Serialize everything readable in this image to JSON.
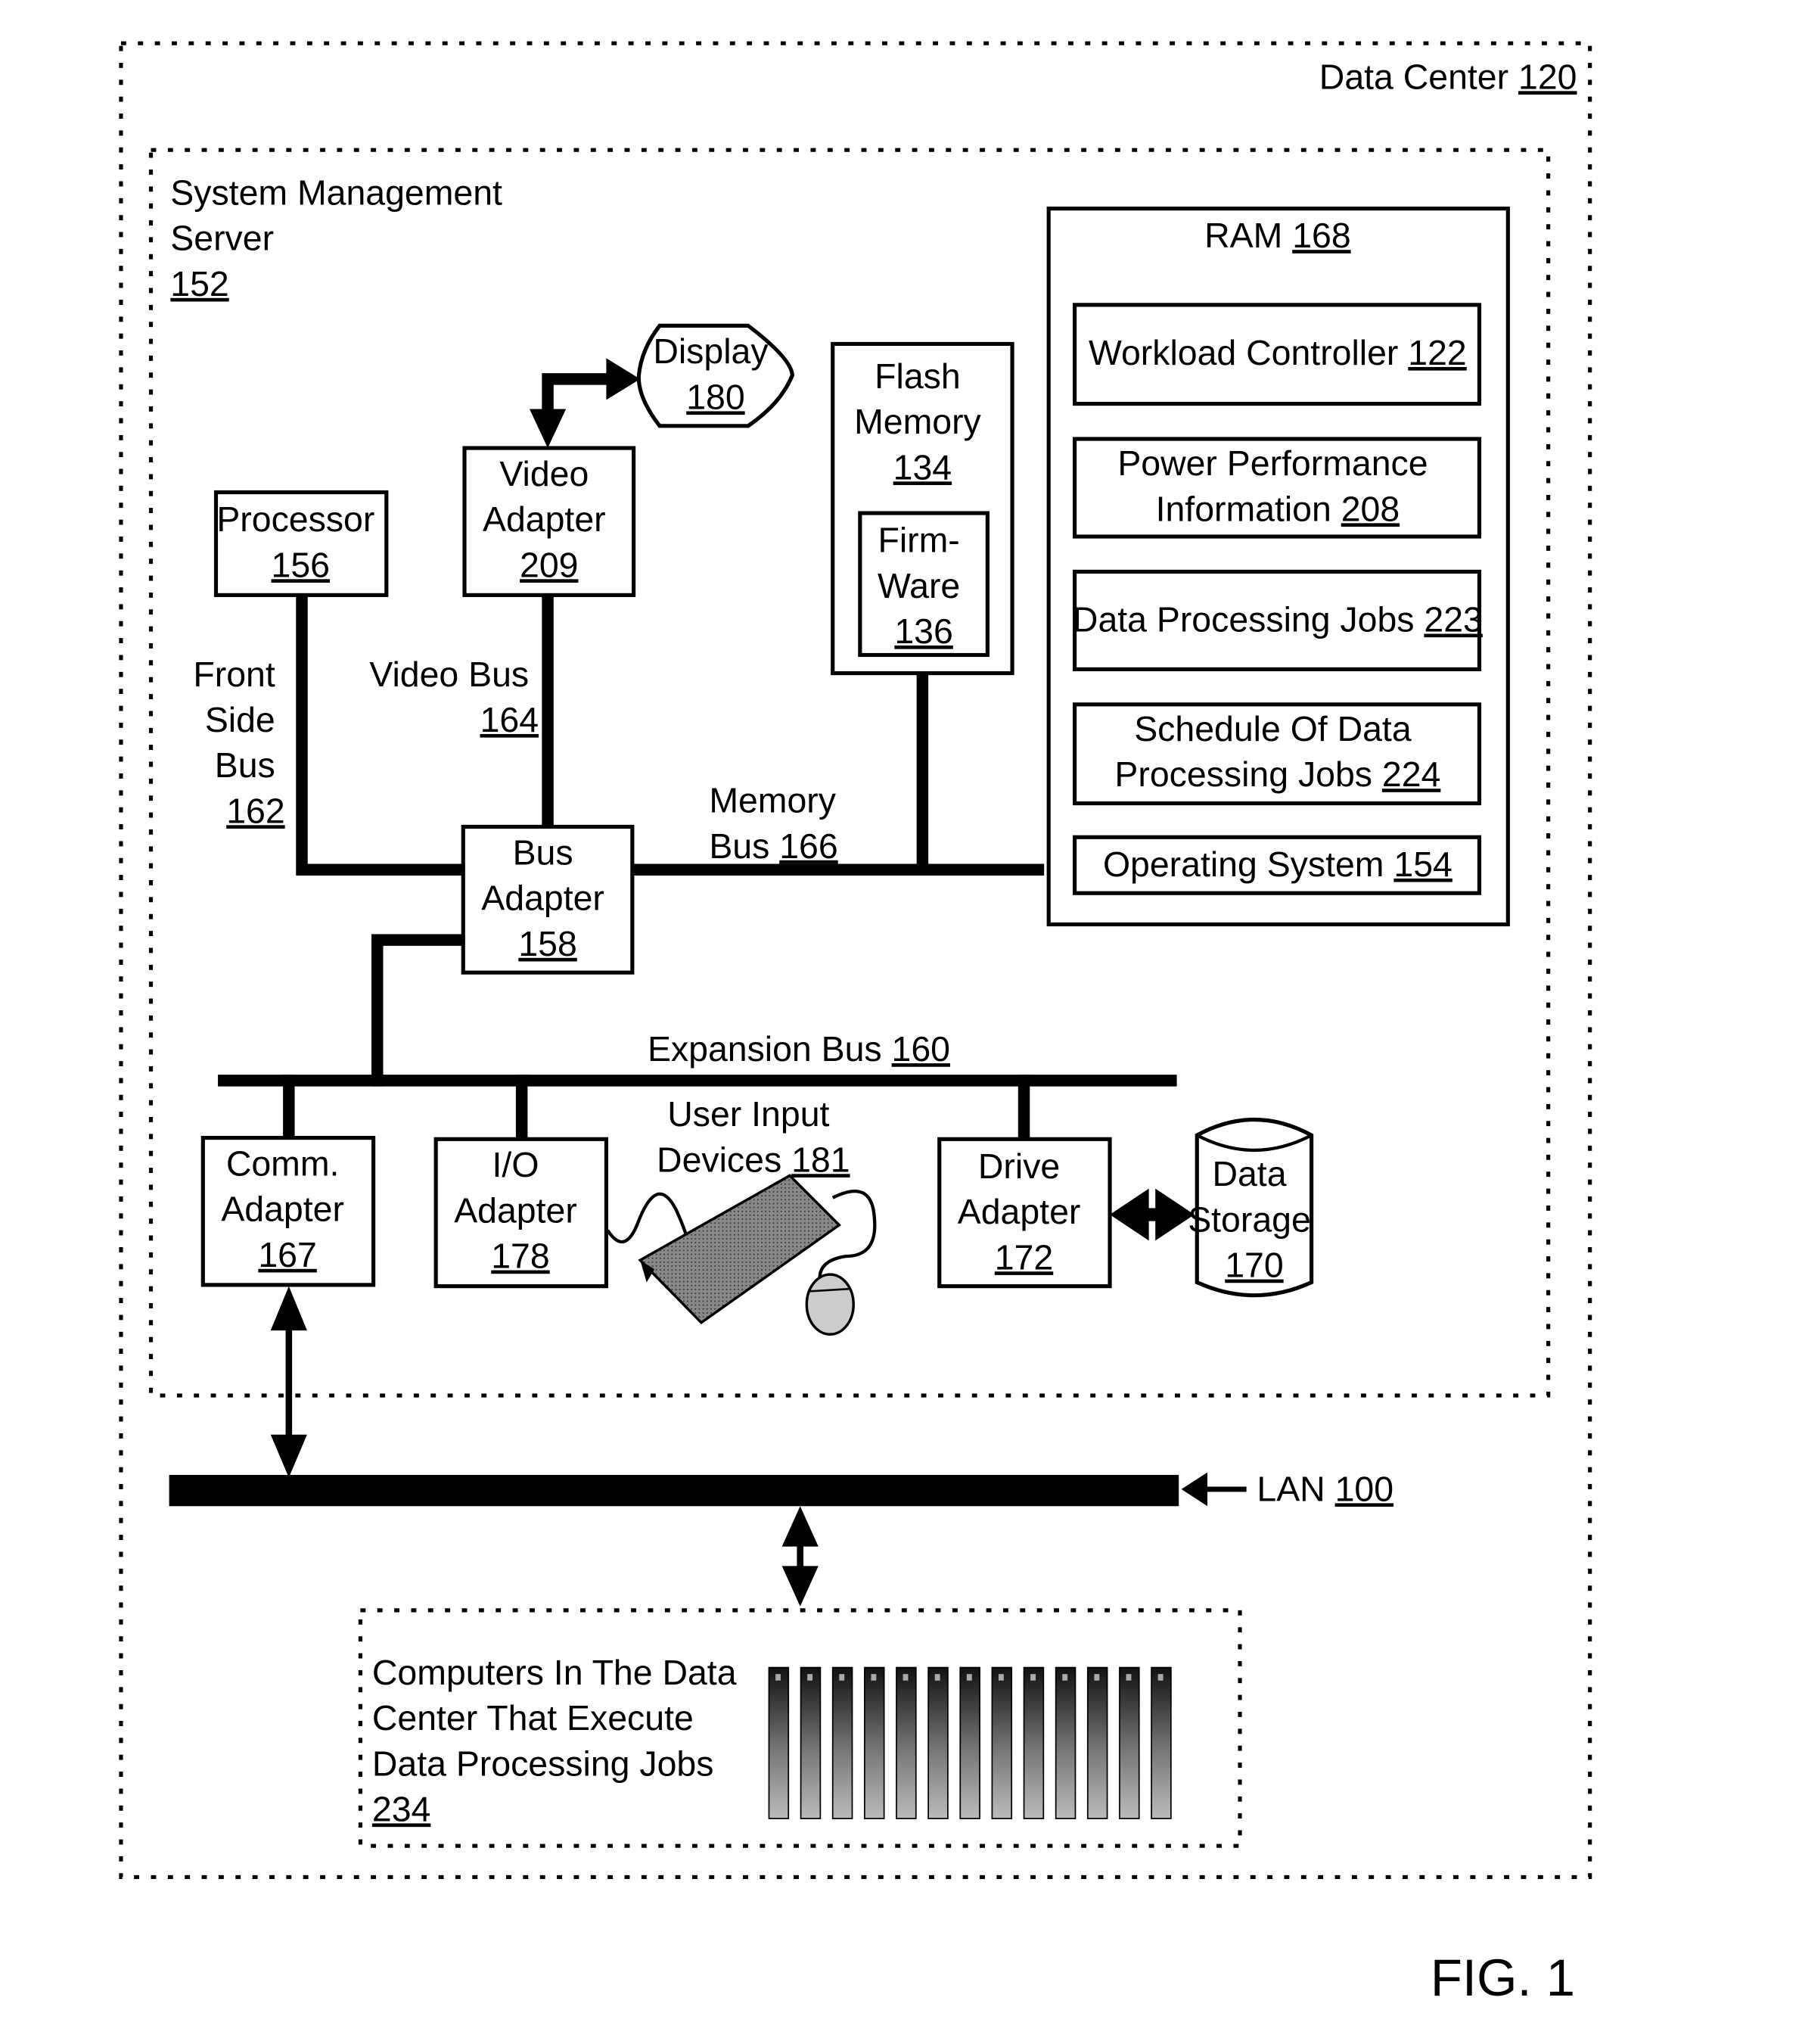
{
  "figure_label": "FIG. 1",
  "data_center": {
    "label": "Data Center",
    "ref": "120"
  },
  "server": {
    "lines": [
      "System Management",
      "Server"
    ],
    "ref": "152"
  },
  "display": {
    "label": "Display",
    "ref": "180"
  },
  "video_adapter": {
    "lines": [
      "Video",
      "Adapter"
    ],
    "ref": "209"
  },
  "processor": {
    "label": "Processor",
    "ref": "156"
  },
  "flash_memory": {
    "lines": [
      "Flash",
      "Memory"
    ],
    "ref": "134"
  },
  "firmware": {
    "lines": [
      "Firm-",
      "Ware"
    ],
    "ref": "136"
  },
  "ram": {
    "label": "RAM",
    "ref": "168",
    "items": [
      {
        "lines": [
          "Workload Controller"
        ],
        "ref": "122"
      },
      {
        "lines": [
          "Power Performance",
          "Information"
        ],
        "ref": "208"
      },
      {
        "lines": [
          "Data Processing Jobs"
        ],
        "ref": "223"
      },
      {
        "lines": [
          "Schedule Of Data",
          "Processing Jobs"
        ],
        "ref": "224"
      },
      {
        "lines": [
          "Operating System"
        ],
        "ref": "154"
      }
    ]
  },
  "front_side_bus": {
    "lines": [
      "Front",
      "Side",
      "Bus"
    ],
    "ref": "162"
  },
  "video_bus": {
    "label": "Video Bus",
    "ref": "164"
  },
  "memory_bus": {
    "lines": [
      "Memory",
      "Bus"
    ],
    "ref": "166"
  },
  "bus_adapter": {
    "lines": [
      "Bus",
      "Adapter"
    ],
    "ref": "158"
  },
  "expansion_bus": {
    "label": "Expansion Bus",
    "ref": "160"
  },
  "comm_adapter": {
    "lines": [
      "Comm.",
      "Adapter"
    ],
    "ref": "167"
  },
  "io_adapter": {
    "lines": [
      "I/O",
      "Adapter"
    ],
    "ref": "178"
  },
  "user_input": {
    "lines": [
      "User Input",
      "Devices"
    ],
    "ref": "181"
  },
  "drive_adapter": {
    "lines": [
      "Drive",
      "Adapter"
    ],
    "ref": "172"
  },
  "data_storage": {
    "lines": [
      "Data",
      "Storage"
    ],
    "ref": "170"
  },
  "lan": {
    "label": "LAN",
    "ref": "100"
  },
  "computers": {
    "lines": [
      "Computers In The Data",
      "Center That Execute",
      "Data Processing Jobs"
    ],
    "ref": "234",
    "server_count": 13
  }
}
